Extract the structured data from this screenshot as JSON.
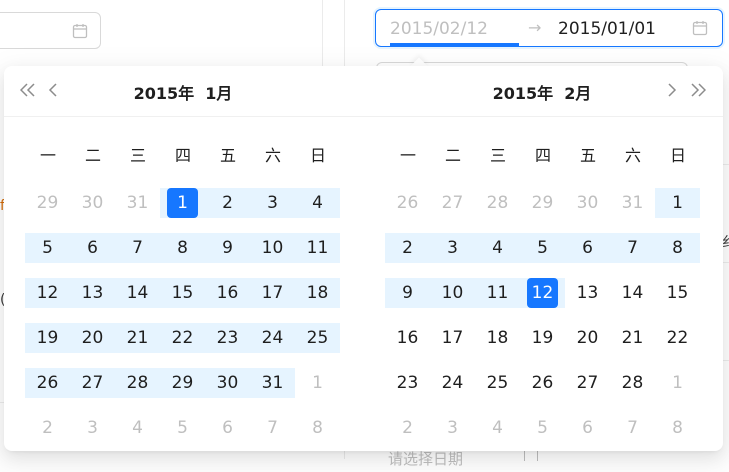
{
  "range_picker": {
    "start_placeholder": "2015/02/12",
    "separator": "→",
    "end_value": "2015/01/01"
  },
  "background": {
    "partial_placeholder": "请选择日期",
    "fragment_1": "f",
    "fragment_2": "(",
    "fragment_3": "纟"
  },
  "weekdays": [
    "一",
    "二",
    "三",
    "四",
    "五",
    "六",
    "日"
  ],
  "left_panel": {
    "year": "2015年",
    "month": "1月",
    "weeks": [
      [
        {
          "d": "29",
          "out": true
        },
        {
          "d": "30",
          "out": true
        },
        {
          "d": "31",
          "out": true
        },
        {
          "d": "1",
          "sel": true,
          "band": true
        },
        {
          "d": "2",
          "band": true
        },
        {
          "d": "3",
          "band": true
        },
        {
          "d": "4",
          "band": true
        }
      ],
      [
        {
          "d": "5",
          "band": true
        },
        {
          "d": "6",
          "band": true
        },
        {
          "d": "7",
          "band": true
        },
        {
          "d": "8",
          "band": true
        },
        {
          "d": "9",
          "band": true
        },
        {
          "d": "10",
          "band": true
        },
        {
          "d": "11",
          "band": true
        }
      ],
      [
        {
          "d": "12",
          "band": true
        },
        {
          "d": "13",
          "band": true
        },
        {
          "d": "14",
          "band": true
        },
        {
          "d": "15",
          "band": true
        },
        {
          "d": "16",
          "band": true
        },
        {
          "d": "17",
          "band": true
        },
        {
          "d": "18",
          "band": true
        }
      ],
      [
        {
          "d": "19",
          "band": true
        },
        {
          "d": "20",
          "band": true
        },
        {
          "d": "21",
          "band": true
        },
        {
          "d": "22",
          "band": true
        },
        {
          "d": "23",
          "band": true
        },
        {
          "d": "24",
          "band": true
        },
        {
          "d": "25",
          "band": true
        }
      ],
      [
        {
          "d": "26",
          "band": true
        },
        {
          "d": "27",
          "band": true
        },
        {
          "d": "28",
          "band": true
        },
        {
          "d": "29",
          "band": true
        },
        {
          "d": "30",
          "band": true
        },
        {
          "d": "31",
          "band": true
        },
        {
          "d": "1",
          "out": true
        }
      ],
      [
        {
          "d": "2",
          "out": true
        },
        {
          "d": "3",
          "out": true
        },
        {
          "d": "4",
          "out": true
        },
        {
          "d": "5",
          "out": true
        },
        {
          "d": "6",
          "out": true
        },
        {
          "d": "7",
          "out": true
        },
        {
          "d": "8",
          "out": true
        }
      ]
    ]
  },
  "right_panel": {
    "year": "2015年",
    "month": "2月",
    "weeks": [
      [
        {
          "d": "26",
          "out": true
        },
        {
          "d": "27",
          "out": true
        },
        {
          "d": "28",
          "out": true
        },
        {
          "d": "29",
          "out": true
        },
        {
          "d": "30",
          "out": true
        },
        {
          "d": "31",
          "out": true
        },
        {
          "d": "1",
          "band": true
        }
      ],
      [
        {
          "d": "2",
          "band": true
        },
        {
          "d": "3",
          "band": true
        },
        {
          "d": "4",
          "band": true
        },
        {
          "d": "5",
          "band": true
        },
        {
          "d": "6",
          "band": true
        },
        {
          "d": "7",
          "band": true
        },
        {
          "d": "8",
          "band": true
        }
      ],
      [
        {
          "d": "9",
          "band": true
        },
        {
          "d": "10",
          "band": true
        },
        {
          "d": "11",
          "band": true
        },
        {
          "d": "12",
          "sel": true,
          "band": true
        },
        {
          "d": "13"
        },
        {
          "d": "14"
        },
        {
          "d": "15"
        }
      ],
      [
        {
          "d": "16"
        },
        {
          "d": "17"
        },
        {
          "d": "18"
        },
        {
          "d": "19"
        },
        {
          "d": "20"
        },
        {
          "d": "21"
        },
        {
          "d": "22"
        }
      ],
      [
        {
          "d": "23"
        },
        {
          "d": "24"
        },
        {
          "d": "25"
        },
        {
          "d": "26"
        },
        {
          "d": "27"
        },
        {
          "d": "28"
        },
        {
          "d": "1",
          "out": true
        }
      ],
      [
        {
          "d": "2",
          "out": true
        },
        {
          "d": "3",
          "out": true
        },
        {
          "d": "4",
          "out": true
        },
        {
          "d": "5",
          "out": true
        },
        {
          "d": "6",
          "out": true
        },
        {
          "d": "7",
          "out": true
        },
        {
          "d": "8",
          "out": true
        }
      ]
    ]
  },
  "colors": {
    "accent": "#1677ff",
    "range_band": "#e6f4ff",
    "muted_text": "#bfbfbf"
  }
}
